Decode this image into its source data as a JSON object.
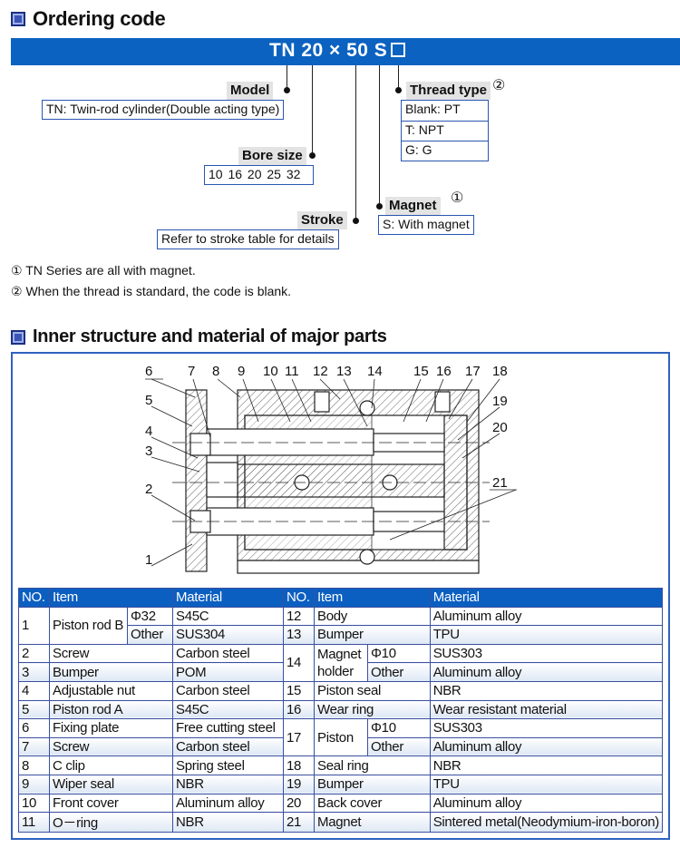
{
  "ordering": {
    "title": "Ordering code",
    "code": "TN 20 × 50 S",
    "model_label": "Model",
    "model_desc": "TN: Twin-rod cylinder(Double acting type)",
    "bore_label": "Bore size",
    "bore_values": "10  16  20  25  32",
    "stroke_label": "Stroke",
    "stroke_desc": "Refer to stroke table for details",
    "magnet_label": "Magnet",
    "magnet_mark": "①",
    "magnet_desc": "S: With magnet",
    "thread_label": "Thread type",
    "thread_mark": "②",
    "thread_options": [
      "Blank: PT",
      "T: NPT",
      "G: G"
    ],
    "notes": [
      "① TN Series are all with magnet.",
      "② When the thread is standard, the code is blank."
    ]
  },
  "structure": {
    "title": "Inner structure and material of major parts",
    "callouts": [
      "1",
      "2",
      "3",
      "4",
      "5",
      "6",
      "7",
      "8",
      "9",
      "10",
      "11",
      "12",
      "13",
      "14",
      "15",
      "16",
      "17",
      "18",
      "19",
      "20",
      "21"
    ],
    "headers": [
      "NO.",
      "Item",
      "Material",
      "NO.",
      "Item",
      "Material"
    ],
    "left": [
      {
        "no": "1",
        "item": "Piston rod B",
        "subs": [
          {
            "sub": "Φ32",
            "mat": "S45C"
          },
          {
            "sub": "Other",
            "mat": "SUS304"
          }
        ]
      },
      {
        "no": "2",
        "item": "Screw",
        "mat": "Carbon steel"
      },
      {
        "no": "3",
        "item": "Bumper",
        "mat": "POM"
      },
      {
        "no": "4",
        "item": "Adjustable nut",
        "mat": "Carbon steel"
      },
      {
        "no": "5",
        "item": "Piston rod A",
        "mat": "S45C"
      },
      {
        "no": "6",
        "item": "Fixing plate",
        "mat": "Free cutting steel"
      },
      {
        "no": "7",
        "item": "Screw",
        "mat": "Carbon steel"
      },
      {
        "no": "8",
        "item": "C clip",
        "mat": "Spring steel"
      },
      {
        "no": "9",
        "item": "Wiper seal",
        "mat": "NBR"
      },
      {
        "no": "10",
        "item": "Front cover",
        "mat": "Aluminum alloy"
      },
      {
        "no": "11",
        "item": "O－ring",
        "mat": "NBR"
      }
    ],
    "right": [
      {
        "no": "12",
        "item": "Body",
        "mat": "Aluminum alloy"
      },
      {
        "no": "13",
        "item": "Bumper",
        "mat": "TPU"
      },
      {
        "no": "14",
        "item_a": "Magnet",
        "item_b": "holder",
        "subs": [
          {
            "sub": "Φ10",
            "mat": "SUS303"
          },
          {
            "sub": "Other",
            "mat": "Aluminum alloy"
          }
        ]
      },
      {
        "no": "15",
        "item": "Piston seal",
        "mat": "NBR"
      },
      {
        "no": "16",
        "item": "Wear ring",
        "mat": "Wear resistant material"
      },
      {
        "no": "17",
        "item": "Piston",
        "subs": [
          {
            "sub": "Φ10",
            "mat": "SUS303"
          },
          {
            "sub": "Other",
            "mat": "Aluminum alloy"
          }
        ]
      },
      {
        "no": "18",
        "item": "Seal ring",
        "mat": "NBR"
      },
      {
        "no": "19",
        "item": "Bumper",
        "mat": "TPU"
      },
      {
        "no": "20",
        "item": "Back cover",
        "mat": "Aluminum alloy"
      },
      {
        "no": "21",
        "item": "Magnet",
        "mat": "Sintered metal(Neodymium-iron-boron)"
      }
    ]
  },
  "colors": {
    "accent": "#0b62c0",
    "border": "#2f62c0"
  }
}
